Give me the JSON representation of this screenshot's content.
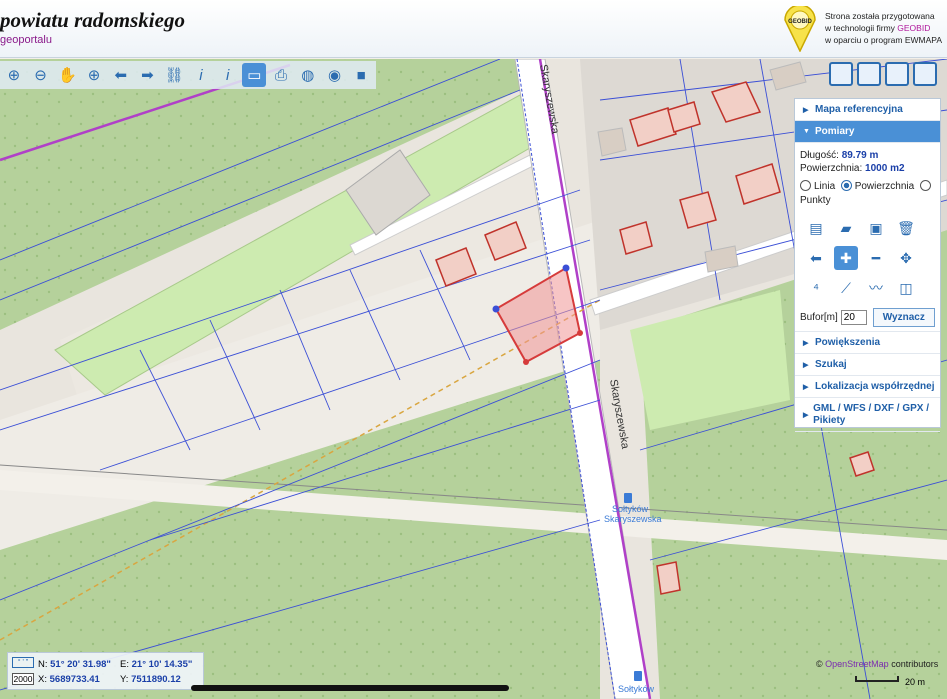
{
  "header": {
    "title": "powiatu radomskiego",
    "subtitle": "geoportalu",
    "credit_line1": "Strona została przygotowana",
    "credit_line2_prefix": "w technologii firmy ",
    "credit_brand": "GEOBID",
    "credit_line3": "w oparciu o program EWMAPA",
    "logo_text": "GEOBID"
  },
  "toolbar": {
    "tools": [
      {
        "icon": "zoom-in-icon",
        "glyph": "⊕"
      },
      {
        "icon": "zoom-out-icon",
        "glyph": "⊖"
      },
      {
        "icon": "pan-hand-icon",
        "glyph": "✋"
      },
      {
        "icon": "zoom-window-icon",
        "glyph": "⊕"
      },
      {
        "icon": "arrow-left-icon",
        "glyph": "⬅"
      },
      {
        "icon": "arrow-right-icon",
        "glyph": "➡"
      },
      {
        "icon": "link-icon",
        "glyph": "🔗"
      },
      {
        "icon": "info-icon",
        "glyph": "ℹ"
      },
      {
        "icon": "info-list-icon",
        "glyph": "ℹ"
      },
      {
        "icon": "ruler-icon",
        "glyph": "📏"
      },
      {
        "icon": "print-icon",
        "glyph": "🖶"
      },
      {
        "icon": "globe-icon",
        "glyph": "🌐"
      },
      {
        "icon": "target-icon",
        "glyph": "◉"
      },
      {
        "icon": "camera-icon",
        "glyph": "🎥"
      }
    ]
  },
  "panel": {
    "items": {
      "reference_map": "Mapa referencyjna",
      "measurements": "Pomiary",
      "zoom": "Powiększenia",
      "search": "Szukaj",
      "coord_location": "Lokalizacja współrzędnej",
      "export": "GML / WFS / DXF / GPX / Pikiety"
    },
    "measure": {
      "length_label": "Długość:",
      "length_value": "89.79 m",
      "area_label": "Powierzchnia:",
      "area_value": "1000 m2",
      "option_line": "Linia",
      "option_area": "Powierzchnia",
      "option_points": "Punkty",
      "selected_option": "Powierzchnia",
      "buffer_label": "Bufor[m]",
      "buffer_value": "20",
      "compute_button": "Wyznacz"
    }
  },
  "map": {
    "street_name": "Skaryszewska",
    "stop_name_line1": "Sołtyków",
    "stop_name_line2": "Skaryszewska",
    "stop_name_bottom": "Sołtyków"
  },
  "coordinates": {
    "n_label": "N:",
    "n_value": "51° 20' 31.98\"",
    "e_label": "E:",
    "e_value": "21° 10' 14.35\"",
    "x_label": "X:",
    "x_value": "5689733.41",
    "y_label": "Y:",
    "y_value": "7511890.12",
    "scale_value": "2000"
  },
  "attribution": {
    "prefix": "© ",
    "osm": "OpenStreetMap",
    "suffix": " contributors",
    "scale_label": "20 m"
  },
  "colors": {
    "forest": "#b5d19b",
    "grass": "#cdebb0",
    "road": "#ffffff",
    "parcel_line": "#3b4fd6",
    "building": "#c0332b",
    "measure_fill": "#f0b0b0",
    "panel_accent": "#4a90d6"
  }
}
